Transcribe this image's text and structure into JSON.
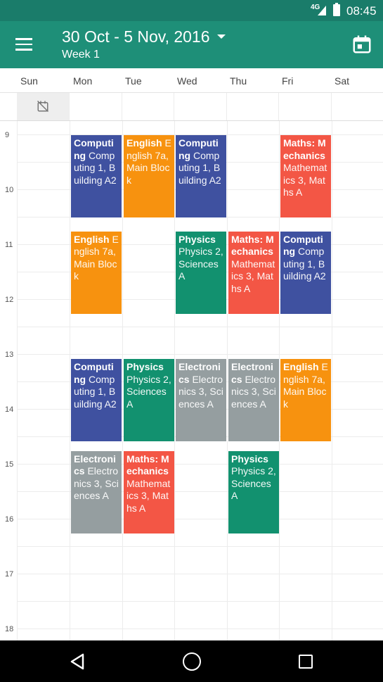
{
  "status_bar": {
    "network": "4G",
    "time": "08:45"
  },
  "app_bar": {
    "title": "30 Oct - 5 Nov, 2016",
    "subtitle": "Week 1",
    "menu_icon": "hamburger-menu-icon",
    "action_icon": "calendar-today-icon"
  },
  "days": [
    "Sun",
    "Mon",
    "Tue",
    "Wed",
    "Thu",
    "Fri",
    "Sat"
  ],
  "allday": {
    "sun_icon": "no-events-icon"
  },
  "hours": [
    "9",
    "10",
    "11",
    "12",
    "13",
    "14",
    "15",
    "16",
    "17",
    "18"
  ],
  "colors": {
    "appbar": "#1e8f78",
    "statusbar": "#1a7c6a",
    "blue": "#3f51a0",
    "orange": "#f7920f",
    "red": "#f35645",
    "green": "#12916f",
    "grey": "#959ea0"
  },
  "events": [
    {
      "day": "Mon",
      "start": 9,
      "end": 10.5,
      "title": "Computing",
      "detail": "Computing 1, Building A2",
      "color": "blue"
    },
    {
      "day": "Tue",
      "start": 9,
      "end": 10.5,
      "title": "English",
      "detail": "English 7a, Main Block",
      "color": "orange"
    },
    {
      "day": "Wed",
      "start": 9,
      "end": 10.5,
      "title": "Computing",
      "detail": "Computing 1, Building A2",
      "color": "blue"
    },
    {
      "day": "Fri",
      "start": 9,
      "end": 10.5,
      "title": "Maths: Mechanics",
      "detail": "Mathematics 3, Maths A",
      "color": "red"
    },
    {
      "day": "Mon",
      "start": 10.75,
      "end": 12.25,
      "title": "English",
      "detail": "English 7a, Main Block",
      "color": "orange"
    },
    {
      "day": "Wed",
      "start": 10.75,
      "end": 12.25,
      "title": "Physics",
      "detail": "Physics 2, Sciences A",
      "color": "green"
    },
    {
      "day": "Thu",
      "start": 10.75,
      "end": 12.25,
      "title": "Maths: Mechanics",
      "detail": "Mathematics 3, Maths A",
      "color": "red"
    },
    {
      "day": "Fri",
      "start": 10.75,
      "end": 12.25,
      "title": "Computing",
      "detail": "Computing 1, Building A2",
      "color": "blue"
    },
    {
      "day": "Mon",
      "start": 13.083,
      "end": 14.583,
      "title": "Computing",
      "detail": "Computing 1, Building A2",
      "color": "blue"
    },
    {
      "day": "Tue",
      "start": 13.083,
      "end": 14.583,
      "title": "Physics",
      "detail": "Physics 2, Sciences A",
      "color": "green"
    },
    {
      "day": "Wed",
      "start": 13.083,
      "end": 14.583,
      "title": "Electronics",
      "detail": "Electronics 3, Sciences A",
      "color": "grey"
    },
    {
      "day": "Thu",
      "start": 13.083,
      "end": 14.583,
      "title": "Electronics",
      "detail": "Electronics 3, Sciences A",
      "color": "grey"
    },
    {
      "day": "Fri",
      "start": 13.083,
      "end": 14.583,
      "title": "English",
      "detail": "English 7a, Main Block",
      "color": "orange"
    },
    {
      "day": "Mon",
      "start": 14.75,
      "end": 16.25,
      "title": "Electronics",
      "detail": "Electronics 3, Sciences A",
      "color": "grey"
    },
    {
      "day": "Tue",
      "start": 14.75,
      "end": 16.25,
      "title": "Maths: Mechanics",
      "detail": "Mathematics 3, Maths A",
      "color": "red"
    },
    {
      "day": "Thu",
      "start": 14.75,
      "end": 16.25,
      "title": "Physics",
      "detail": "Physics 2, Sciences A",
      "color": "green"
    }
  ],
  "nav": {
    "back_icon": "back-icon",
    "home_icon": "home-icon",
    "recent_icon": "recent-apps-icon"
  }
}
